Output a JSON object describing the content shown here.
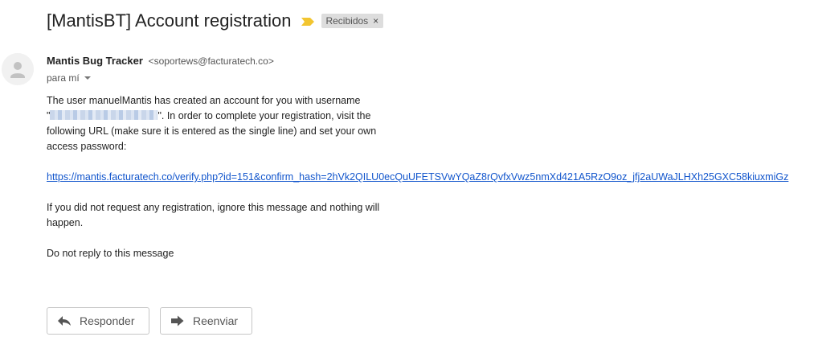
{
  "email": {
    "subject": "[MantisBT] Account registration",
    "label_chip": "Recibidos",
    "label_chip_close": "×",
    "sender_name": "Mantis Bug Tracker",
    "sender_email": "<soportews@facturatech.co>",
    "recipient": "para mí",
    "body": {
      "p1_a": "The user manuelMantis has created an account for you with username",
      "p1_b_quote_open": "\"",
      "p1_b_rest": "\". In order to complete your registration, visit the",
      "p1_c": "following URL (make sure it is entered as the single line) and set your own",
      "p1_d": "access password:",
      "verify_url": "https://mantis.facturatech.co/verify.php?id=151&confirm_hash=2hVk2QILU0ecQuUFETSVwYQaZ8rQvfxVwz5nmXd421A5RzO9oz_jfj2aUWaJLHXh25GXC58kiuxmiGz",
      "p2_a": "If you did not request any registration, ignore this message and nothing will",
      "p2_b": "happen.",
      "p3": "Do not reply to this message"
    }
  },
  "actions": {
    "reply_label": "Responder",
    "forward_label": "Reenviar"
  },
  "icons": {
    "importance": "importance-marker-icon",
    "avatar": "person-icon",
    "reply": "reply-icon",
    "forward": "forward-icon",
    "caret": "chevron-down-icon"
  },
  "colors": {
    "link": "#1155cc",
    "importance": "#f2c530",
    "chip_bg": "#dddddd"
  }
}
